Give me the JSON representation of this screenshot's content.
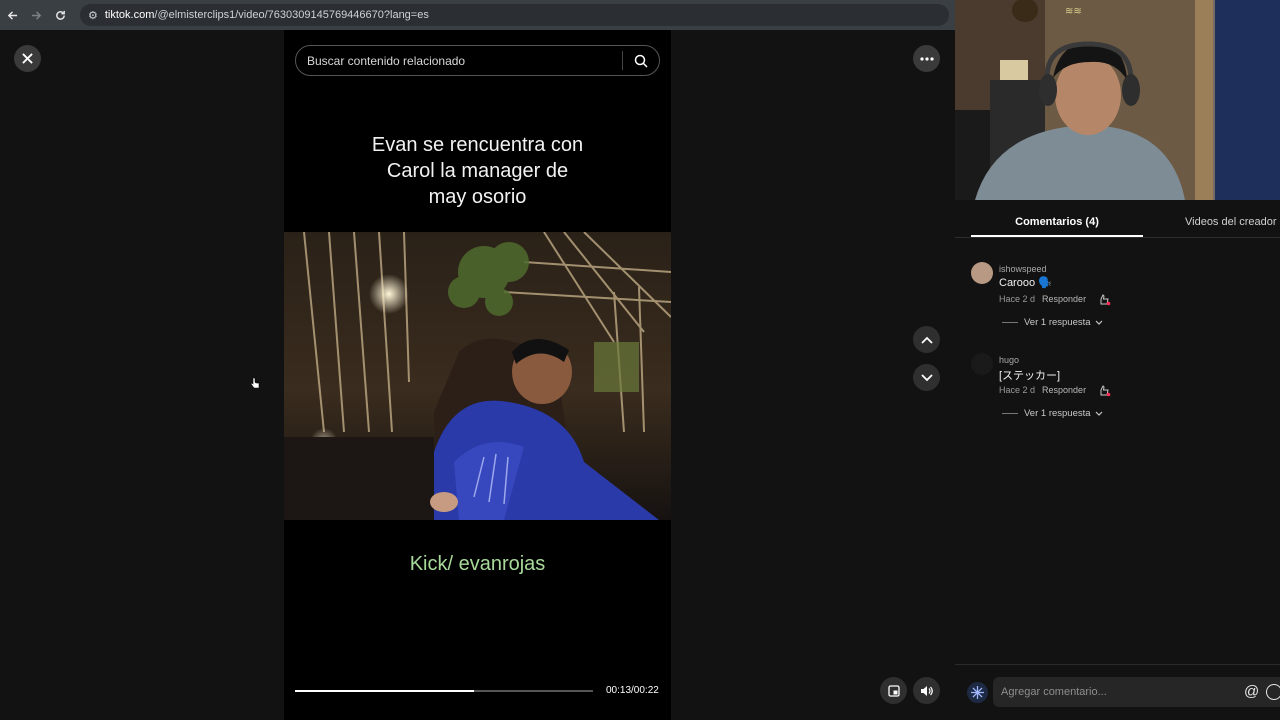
{
  "browser": {
    "url_host": "tiktok.com",
    "url_path": "/@elmisterclips1/video/7630309145769446670?lang=es"
  },
  "search": {
    "placeholder": "Buscar contenido relacionado"
  },
  "video": {
    "title_lines": [
      "Evan se rencuentra con",
      "Carol la manager de",
      "may osorio"
    ],
    "credit": "Kick/ evanrojas",
    "time": "00:13/00:22",
    "progress": 0.6
  },
  "tabs": {
    "comments": "Comentarios (4)",
    "creator_videos": "Videos del creador"
  },
  "comments": [
    {
      "user": "ishowspeed",
      "text": "Carooo 🗣️",
      "meta": "Hace 2 d",
      "reply_label": "Responder",
      "replies": "Ver 1 respuesta",
      "avatar_color": "#b89a84"
    },
    {
      "user": "hugo",
      "text": "[ステッカー]",
      "meta": "Hace 2 d",
      "reply_label": "Responder",
      "replies": "Ver 1 respuesta",
      "avatar_color": "#1a1a1a"
    }
  ],
  "composer": {
    "placeholder": "Agregar comentario..."
  },
  "icons": {
    "close": "close-icon",
    "more": "more-icon",
    "search": "search-icon",
    "up": "chevron-up-icon",
    "down": "chevron-down-icon",
    "pip": "picture-in-picture-icon",
    "volume": "volume-icon",
    "like": "like-icon",
    "mention": "at-icon",
    "emoji": "emoji-icon"
  }
}
